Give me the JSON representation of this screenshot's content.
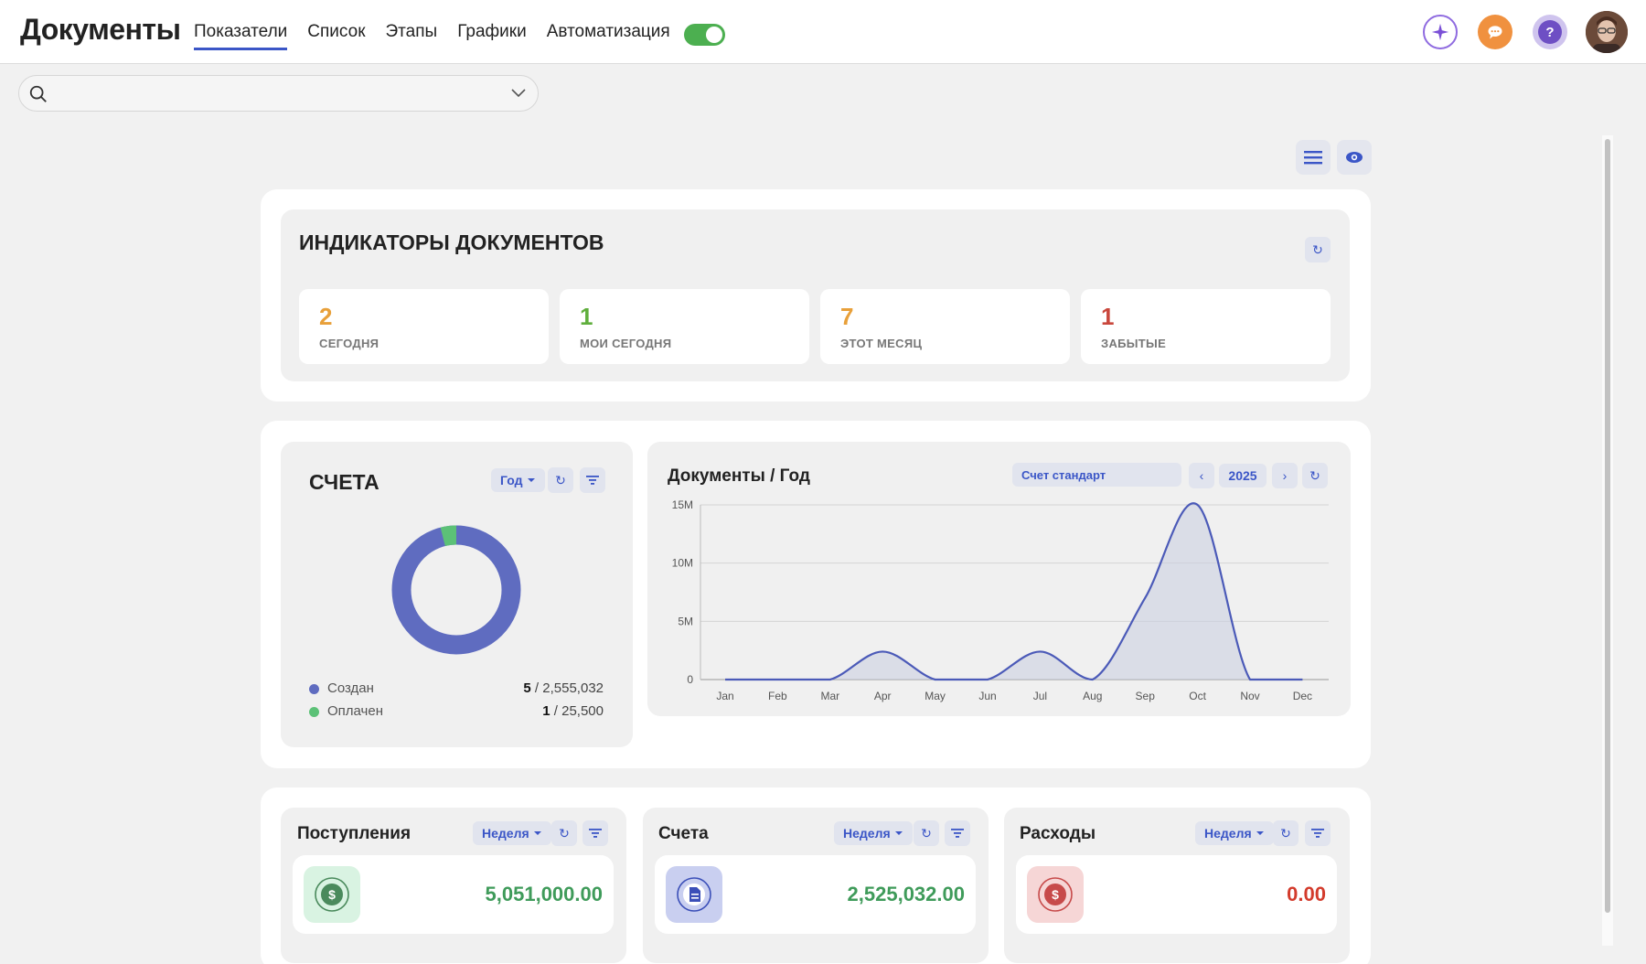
{
  "app": {
    "title": "Документы"
  },
  "nav": [
    {
      "label": "Показатели",
      "active": true
    },
    {
      "label": "Список"
    },
    {
      "label": "Этапы"
    },
    {
      "label": "Графики"
    },
    {
      "label": "Автоматизация"
    }
  ],
  "toggle": {
    "on": true,
    "color": "#4caf50"
  },
  "top_icons": [
    "sparkle-icon",
    "chat-icon",
    "help-icon",
    "user-avatar"
  ],
  "help_icon_char": "?",
  "search": {
    "placeholder": "",
    "value": ""
  },
  "indicators": {
    "title": "ИНДИКАТОРЫ ДОКУМЕНТОВ",
    "refresh": "↻",
    "items": [
      {
        "value": "2",
        "label": "СЕГОДНЯ",
        "color": "#e8a03a"
      },
      {
        "value": "1",
        "label": "МОИ СЕГОДНЯ",
        "color": "#5fae3c"
      },
      {
        "value": "7",
        "label": "ЭТОТ МЕСЯЦ",
        "color": "#e8a03a"
      },
      {
        "value": "1",
        "label": "ЗАБЫТЫЕ",
        "color": "#c9473c"
      }
    ]
  },
  "invoices": {
    "title": "СЧЕТА",
    "period": "Год",
    "refresh": "↻",
    "legend": [
      {
        "name": "Создан",
        "count": "5",
        "amount": " / 2,555,032",
        "color": "#5f6cc0"
      },
      {
        "name": "Оплачен",
        "count": "1",
        "amount": " / 25,500",
        "color": "#5cc177"
      }
    ],
    "donut_fraction_green": 0.12
  },
  "doc_chart": {
    "title": "Документы / Год",
    "doc_type": "Счет стандарт",
    "year": "2025",
    "prev": "‹",
    "next": "›",
    "refresh": "↻"
  },
  "chart_data": {
    "type": "area",
    "title": "Документы / Год",
    "categories": [
      "Jan",
      "Feb",
      "Mar",
      "Apr",
      "May",
      "Jun",
      "Jul",
      "Aug",
      "Sep",
      "Oct",
      "Nov",
      "Dec"
    ],
    "values": [
      0,
      0,
      0,
      2400000,
      0,
      0,
      2400000,
      0,
      7000000,
      15000000,
      0,
      0
    ],
    "yticks": [
      "0",
      "5M",
      "10M",
      "15M"
    ],
    "ylim": [
      0,
      15000000
    ],
    "grid": true,
    "color": "#4b5ab8"
  },
  "bottom": [
    {
      "title": "Поступления",
      "period": "Неделя",
      "amount": "5,051,000.00",
      "amount_color": "#3f9b5a",
      "icon_bg": "#d9f3e2",
      "icon_fg": "#4a8a5c",
      "icon": "dollar-coin-icon"
    },
    {
      "title": "Счета",
      "period": "Неделя",
      "amount": "2,525,032.00",
      "amount_color": "#3f9b5a",
      "icon_bg": "#c9cff0",
      "icon_fg": "#3b4fb8",
      "icon": "document-icon"
    },
    {
      "title": "Расходы",
      "period": "Неделя",
      "amount": "0.00",
      "amount_color": "#d33b2c",
      "icon_bg": "#f6d6d6",
      "icon_fg": "#c74a4a",
      "icon": "dollar-coin-icon"
    }
  ],
  "refresh_symbol": "↻"
}
